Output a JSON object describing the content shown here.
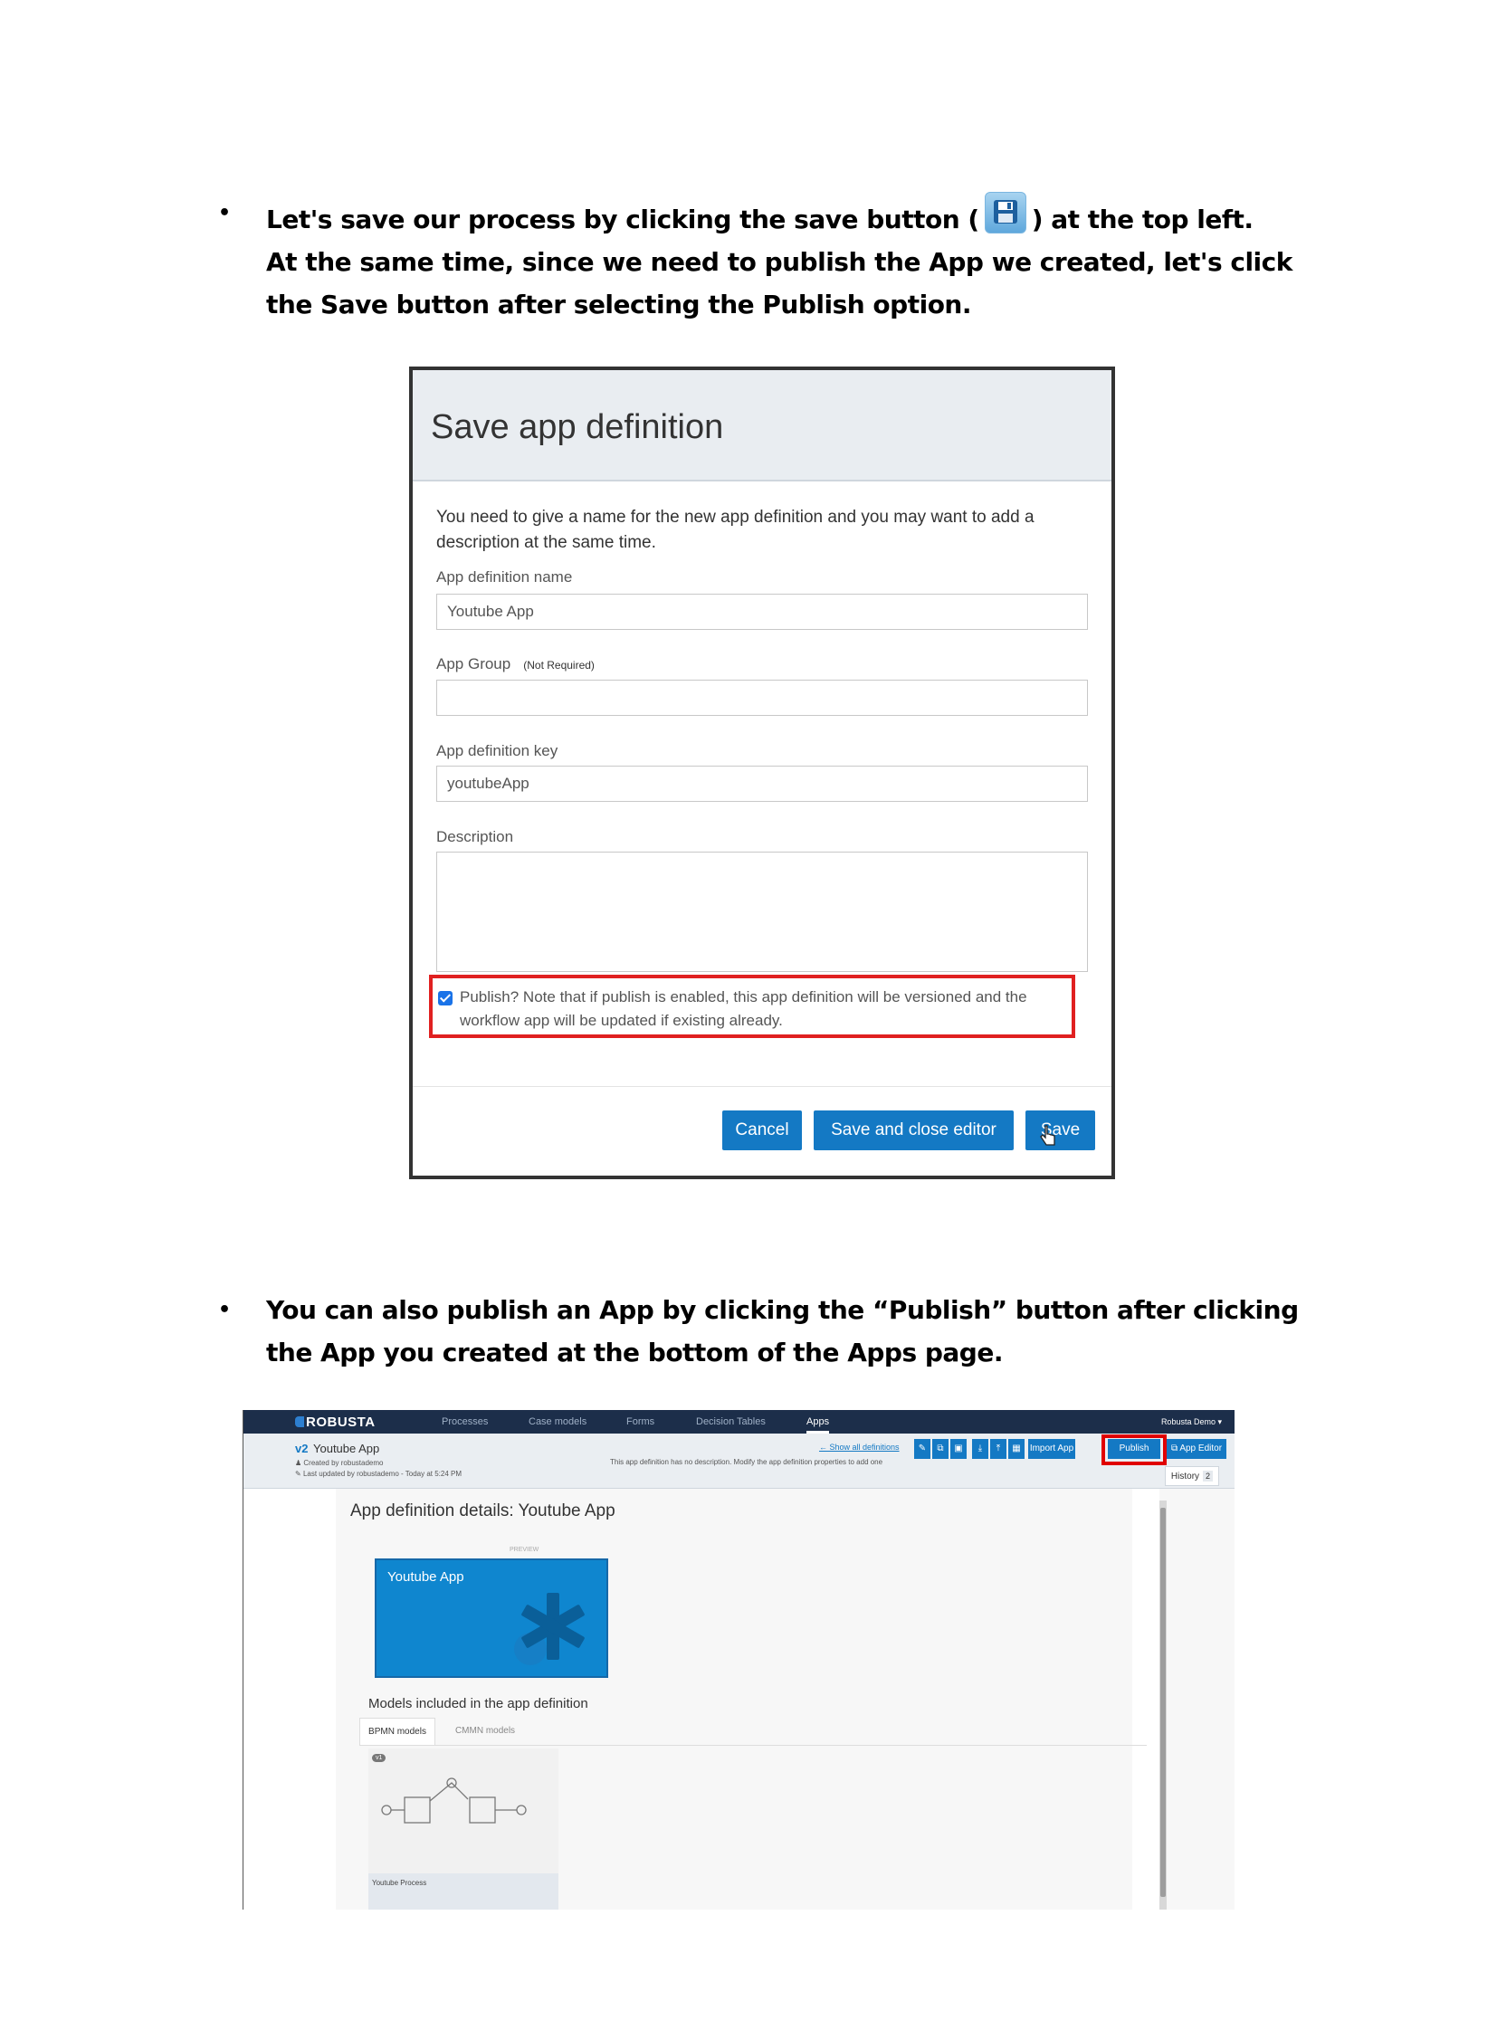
{
  "bullets": {
    "b1_dot": "•",
    "b1_line1_pre": "Let's save our process by clicking the save button (",
    "b1_line1_post": ") at the top left.",
    "b1_line2": "At the same time, since we need to publish the App we created, let's click",
    "b1_line3": "the Save button after selecting the Publish option.",
    "b2_dot": "•",
    "b2_line1": "You can also publish an App by clicking the “Publish” button after clicking",
    "b2_line2": "the App you created at the bottom of the Apps page."
  },
  "dialog": {
    "title": "Save app definition",
    "intro": "You need to give a name for the new app definition and you may want to add a description at the same time.",
    "name_label": "App definition name",
    "name_value": "Youtube App",
    "group_label": "App Group",
    "group_note": "(Not Required)",
    "group_value": "",
    "key_label": "App definition key",
    "key_value": "youtubeApp",
    "description_label": "Description",
    "publish_checked": true,
    "publish_text": "Publish? Note that if publish is enabled, this app definition will be versioned and the workflow app will be updated if existing already.",
    "cancel": "Cancel",
    "save_close": "Save and close editor",
    "save": "Save"
  },
  "apps_page": {
    "logo": "ROBUSTA",
    "nav": [
      "Processes",
      "Case models",
      "Forms",
      "Decision Tables",
      "Apps"
    ],
    "active_nav": "Apps",
    "user": "Robusta Demo ▾",
    "version": "v2",
    "app_title": "Youtube App",
    "created_by": "Created by robustademo",
    "last_updated": "Last updated by robustademo - Today at 5:24 PM",
    "no_description": "This app definition has no description. Modify the app definition properties to add one",
    "show_all": "← Show all definitions",
    "import_app": "Import App",
    "publish": "Publish",
    "app_editor": "App Editor",
    "history": "History",
    "history_count": "2",
    "details_title": "App definition details: Youtube App",
    "preview": "PREVIEW",
    "tile_name": "Youtube App",
    "tile_color": "#0f86cf",
    "models_title": "Models included in the app definition",
    "tab_bpmn": "BPMN models",
    "tab_cmmn": "CMMN models",
    "model_version": "v1",
    "model_name": "Youtube Process",
    "highlight_color": "#e00000"
  }
}
